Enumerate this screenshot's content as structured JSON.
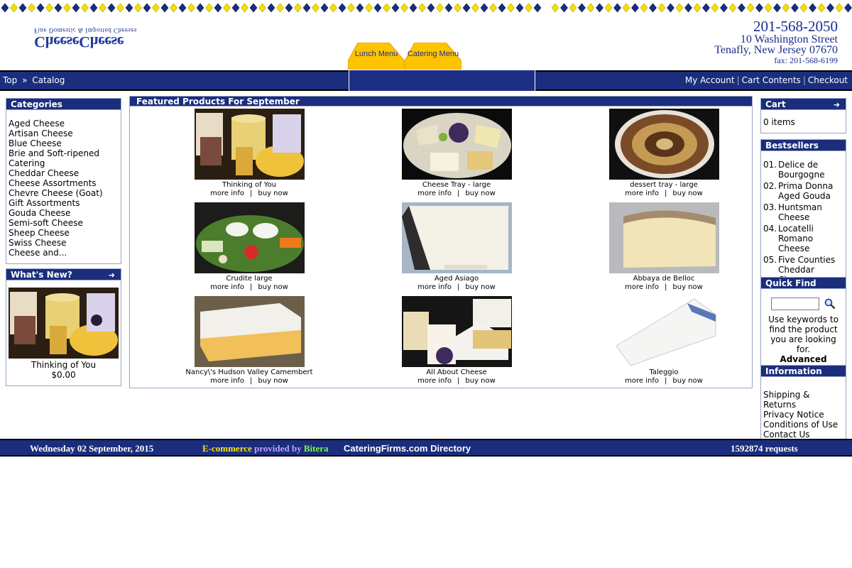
{
  "header": {
    "logo_tagline": "Fine Domestic & Imported Cheeses",
    "logo_name": "CheeseCheese",
    "phone": "201-568-2050",
    "street": "10 Washington Street",
    "city": "Tenafly, New Jersey 07670",
    "fax": "fax: 201-568-6199",
    "lunch_menu": "Lunch Menu",
    "catering_menu": "Catering Menu"
  },
  "nav": {
    "breadcrumb_top": "Top",
    "breadcrumb_sep": "»",
    "breadcrumb_catalog": "Catalog",
    "my_account": "My Account",
    "cart_contents": "Cart Contents",
    "checkout": "Checkout",
    "link_sep": "|"
  },
  "categories": {
    "title": "Categories",
    "items": [
      "Aged Cheese",
      "Artisan Cheese",
      "Blue Cheese",
      "Brie and Soft-ripened",
      "Catering",
      "Cheddar Cheese",
      "Cheese Assortments",
      "Chevre Cheese (Goat)",
      "Gift Assortments",
      "Gouda Cheese",
      "Semi-soft Cheese",
      "Sheep Cheese",
      "Swiss Cheese",
      "Cheese and..."
    ]
  },
  "whats_new": {
    "title": "What's New?",
    "product_name": "Thinking of You",
    "price": "$0.00"
  },
  "featured": {
    "title": "Featured Products For September",
    "more_info": "more info",
    "buy_now": "buy now",
    "sep": "|",
    "products": [
      "Thinking of You",
      "Cheese Tray - large",
      "dessert tray - large",
      "Crudite large",
      "Aged Asiago",
      "Abbaya de Belloc",
      "Nancy\\'s Hudson Valley Camembert",
      "All About Cheese",
      "Taleggio"
    ]
  },
  "cart": {
    "title": "Cart",
    "items_text": "0 items"
  },
  "bestsellers": {
    "title": "Bestsellers",
    "items": [
      {
        "num": "01.",
        "line1": "Delice de",
        "line2": "Bourgogne"
      },
      {
        "num": "02.",
        "line1": "Prima Donna",
        "line2": "Aged Gouda"
      },
      {
        "num": "03.",
        "line1": "Huntsman",
        "line2": "Cheese"
      },
      {
        "num": "04.",
        "line1": "Locatelli",
        "line2": "Romano Cheese"
      },
      {
        "num": "05.",
        "line1": "Five Counties",
        "line2": "Cheddar Cheese"
      }
    ]
  },
  "quick_find": {
    "title": "Quick Find",
    "help_text": "Use keywords to find the product you are looking for.",
    "advanced": "Advanced Search",
    "input_value": ""
  },
  "information": {
    "title": "Information",
    "links": [
      "Shipping & Returns",
      "Privacy Notice",
      "Conditions of Use",
      "Contact Us"
    ]
  },
  "footer": {
    "date": "Wednesday 02 September, 2015",
    "ecommerce": "E-commerce",
    "provided": "provided",
    "by": "by",
    "bitera": "Bitera",
    "directory": "CateringFirms.com Directory",
    "requests": "1592874 requests"
  },
  "colors": {
    "navy": "#1a2e7d",
    "link_blue": "#1a2e8c",
    "menu_yellow": "#ffc400",
    "footer_yellow": "#ffe400",
    "footer_violet": "#c89cff",
    "footer_green": "#7cff3c"
  }
}
